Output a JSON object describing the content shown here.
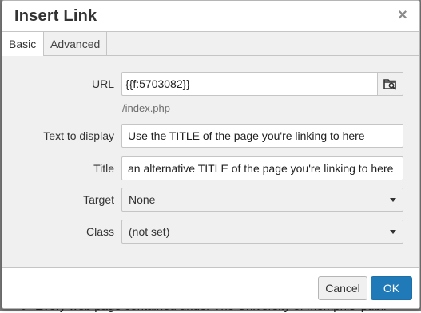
{
  "dialog": {
    "title": "Insert Link",
    "close_glyph": "×"
  },
  "tabs": [
    {
      "label": "Basic",
      "active": true
    },
    {
      "label": "Advanced",
      "active": false
    }
  ],
  "form": {
    "url": {
      "label": "URL",
      "value": "{{f:5703082}}",
      "hint": "/index.php",
      "browse_icon": "browse-file-icon"
    },
    "text_to_display": {
      "label": "Text to display",
      "value": "Use the TITLE of the page you're linking to here"
    },
    "title": {
      "label": "Title",
      "value": "an alternative TITLE of the page you're linking to here"
    },
    "target": {
      "label": "Target",
      "selected": "None"
    },
    "class": {
      "label": "Class",
      "selected": "(not set)"
    }
  },
  "footer": {
    "cancel_label": "Cancel",
    "ok_label": "OK"
  },
  "background": {
    "partial_text": "Every web page contained under The University of Memphis' publi"
  },
  "colors": {
    "primary": "#207ab7",
    "panel_bg": "#f0f0f0",
    "border": "#c5c5c5"
  }
}
